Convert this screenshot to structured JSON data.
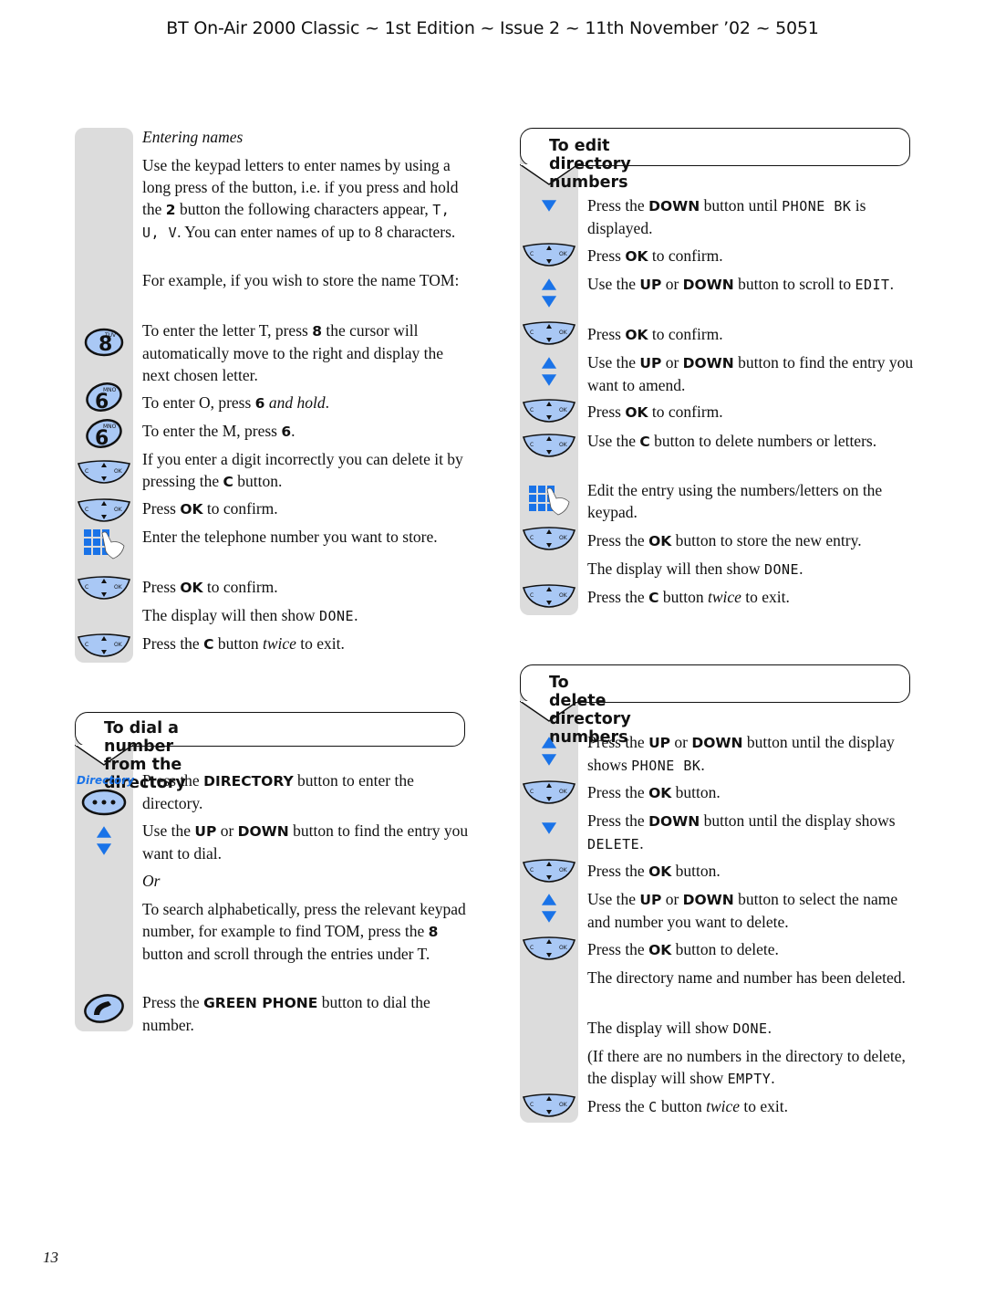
{
  "header": {
    "title": "BT On-Air 2000 Classic ~ 1st Edition ~ Issue 2 ~ 11th November ’02 ~ 5051"
  },
  "page_number": "13",
  "colors": {
    "rail": "#dcdcdc",
    "icon_blue": "#1a73e8",
    "button_fill": "#a9c8f5"
  },
  "entering_names": {
    "heading": "Entering names",
    "p1": {
      "pre": "Use the keypad letters to enter names by using a long press of the button, i.e. if you press and hold the ",
      "b": "2",
      "mid": " button the following characters appear, ",
      "lcd": "T, U, V",
      "post": ". You can enter names of up to 8 characters."
    },
    "p2": "For example, if you wish to store the name TOM:",
    "step_t": {
      "pre": "To enter the letter T, press ",
      "b": "8",
      "post": " the cursor will automatically move to the right and display the next chosen letter.",
      "icon_digit": "8",
      "icon_letters": "TUV"
    },
    "step_o": {
      "pre": "To enter O, press ",
      "b": "6",
      "it": " and hold",
      "post": ".",
      "icon_digit": "6",
      "icon_letters": "MNO"
    },
    "step_m": {
      "pre": "To enter the M, press ",
      "b": "6",
      "post": ".",
      "icon_digit": "6",
      "icon_letters": "MNO"
    },
    "step_c": {
      "pre": "If you enter a digit incorrectly you can delete it by pressing the ",
      "b": "C",
      "post": " button."
    },
    "step_ok1": {
      "pre": "Press ",
      "b": "OK",
      "post": " to confirm."
    },
    "step_num": "Enter the telephone number you want to store.",
    "step_ok2": {
      "pre": "Press ",
      "b": "OK",
      "post": " to confirm."
    },
    "step_done": {
      "pre": "The display will then show ",
      "lcd": "DONE",
      "post": "."
    },
    "step_exit": {
      "pre": "Press the ",
      "b": "C",
      "mid": " button ",
      "it": "twice",
      "post": " to exit."
    }
  },
  "dial_section": {
    "title": "To dial a number from the directory",
    "directory_label": "Directory",
    "s1": {
      "pre": "Press the ",
      "b": "DIRECTORY",
      "post": " button to enter the directory."
    },
    "s2": {
      "pre": "Use the ",
      "b1": "UP",
      "mid": " or ",
      "b2": "DOWN",
      "post": " button to find the entry you want to dial."
    },
    "or": "Or",
    "s3": {
      "pre": "To search alphabetically, press the relevant keypad number, for example to find TOM, press the ",
      "b": "8",
      "post": " button and scroll through the entries under T."
    },
    "s4": {
      "pre": "Press the ",
      "b": "GREEN PHONE",
      "post": " button to dial the number."
    }
  },
  "edit_section": {
    "title": "To edit directory numbers",
    "s1": {
      "pre": "Press the ",
      "b": "DOWN",
      "mid": " button until ",
      "lcd": "PHONE BK",
      "post": " is displayed."
    },
    "s2": {
      "pre": "Press ",
      "b": "OK",
      "post": " to confirm."
    },
    "s3": {
      "pre": "Use the ",
      "b1": "UP",
      "mid": " or ",
      "b2": "DOWN",
      "post": " button to scroll to ",
      "lcd": "EDIT",
      "end": "."
    },
    "s4": {
      "pre": "Press ",
      "b": "OK",
      "post": " to confirm."
    },
    "s5": {
      "pre": "Use the ",
      "b1": "UP",
      "mid": " or ",
      "b2": "DOWN",
      "post": " button to find the entry you want to amend."
    },
    "s6": {
      "pre": "Press ",
      "b": "OK",
      "post": " to confirm."
    },
    "s7": {
      "pre": "Use the ",
      "b": "C",
      "post": " button to delete numbers or letters."
    },
    "s8": "Edit the entry using the numbers/letters on the keypad.",
    "s9": {
      "pre": "Press the ",
      "b": "OK",
      "post": " button to store the new entry."
    },
    "s10": {
      "pre": "The display will then show ",
      "lcd": "DONE",
      "post": "."
    },
    "s11": {
      "pre": "Press the ",
      "b": "C",
      "mid": " button ",
      "it": "twice",
      "post": " to exit."
    }
  },
  "delete_section": {
    "title": "To delete directory numbers",
    "s1": {
      "pre": "Press the ",
      "b1": "UP",
      "mid": " or ",
      "b2": "DOWN",
      "post": " button until the display shows ",
      "lcd": "PHONE BK",
      "end": "."
    },
    "s2": {
      "pre": "Press the ",
      "b": "OK",
      "post": " button."
    },
    "s3": {
      "pre": "Press the ",
      "b": "DOWN",
      "post": " button until the display shows ",
      "lcd": "DELETE",
      "end": "."
    },
    "s4": {
      "pre": "Press the ",
      "b": "OK",
      "post": " button."
    },
    "s5": {
      "pre": "Use the ",
      "b1": "UP",
      "mid": " or ",
      "b2": "DOWN",
      "post": " button to select the name and number you want to delete."
    },
    "s6": {
      "pre": "Press the ",
      "b": "OK",
      "post": " button to delete."
    },
    "s7": "The directory name and number has been deleted.",
    "s8": {
      "pre": "The display will show ",
      "lcd": "DONE",
      "post": "."
    },
    "s9": {
      "pre": "(If there are no numbers in the directory to delete, the display will show ",
      "lcd": "EMPTY",
      "post": "."
    },
    "s10": {
      "pre": "Press the ",
      "lcd": "C",
      "mid": " button ",
      "it": "twice",
      "post": " to exit."
    }
  }
}
